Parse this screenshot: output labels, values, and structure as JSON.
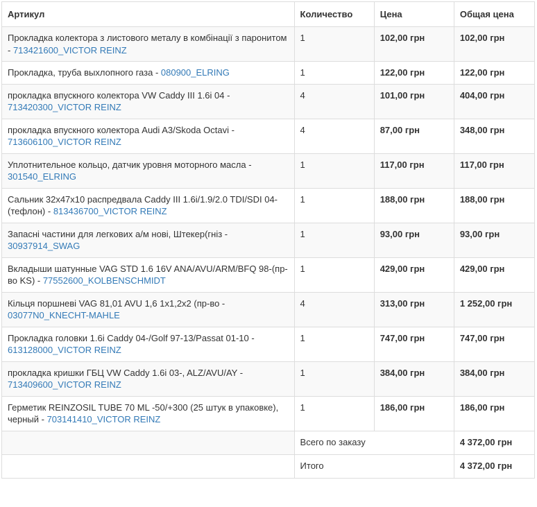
{
  "headers": {
    "article": "Артикул",
    "quantity": "Количество",
    "price": "Цена",
    "total": "Общая цена"
  },
  "rows": [
    {
      "name": "Прокладка колектора з листового металу в комбінації з паронитом - ",
      "sku": "713421600_VICTOR REINZ",
      "qty": "1",
      "price": "102,00 грн",
      "total": "102,00 грн"
    },
    {
      "name": "Прокладка, труба выхлопного газа - ",
      "sku": "080900_ELRING",
      "qty": "1",
      "price": "122,00 грн",
      "total": "122,00 грн"
    },
    {
      "name": "прокладка впускного колектора VW Caddy III 1.6i 04 - ",
      "sku": "713420300_VICTOR REINZ",
      "qty": "4",
      "price": "101,00 грн",
      "total": "404,00 грн"
    },
    {
      "name": "прокладка впускного колектора Audi A3/Skoda Octavi - ",
      "sku": "713606100_VICTOR REINZ",
      "qty": "4",
      "price": "87,00 грн",
      "total": "348,00 грн"
    },
    {
      "name": "Уплотнительное кольцо, датчик уровня моторного масла - ",
      "sku": "301540_ELRING",
      "qty": "1",
      "price": "117,00 грн",
      "total": "117,00 грн"
    },
    {
      "name": "Сальник 32x47x10 распредвала Caddy III 1.6i/1.9/2.0 TDI/SDI 04-(тефлон) - ",
      "sku": "813436700_VICTOR REINZ",
      "qty": "1",
      "price": "188,00 грн",
      "total": "188,00 грн"
    },
    {
      "name": "Запасні частини для легкових а/м нові, Штекер(гніз - ",
      "sku": "30937914_SWAG",
      "qty": "1",
      "price": "93,00 грн",
      "total": "93,00 грн"
    },
    {
      "name": "Вкладыши шатунные VAG STD 1.6 16V ANA/AVU/ARM/BFQ 98-(пр-во KS) - ",
      "sku": "77552600_KOLBENSCHMIDT",
      "qty": "1",
      "price": "429,00 грн",
      "total": "429,00 грн"
    },
    {
      "name": "Кільця поршневі VAG 81,01 AVU 1,6 1x1,2x2 (пр-во - ",
      "sku": "03077N0_KNECHT-MAHLE",
      "qty": "4",
      "price": "313,00 грн",
      "total": "1 252,00 грн"
    },
    {
      "name": "Прокладка головки 1.6i Caddy 04-/Golf 97-13/Passat 01-10 - ",
      "sku": "613128000_VICTOR REINZ",
      "qty": "1",
      "price": "747,00 грн",
      "total": "747,00 грн"
    },
    {
      "name": "прокладка кришки ГБЦ VW Caddy 1.6i 03-, ALZ/AVU/AY - ",
      "sku": "713409600_VICTOR REINZ",
      "qty": "1",
      "price": "384,00 грн",
      "total": "384,00 грн"
    },
    {
      "name": "Герметик REINZOSIL TUBE 70 ML -50/+300 (25 штук в упаковке), черный - ",
      "sku": "703141410_VICTOR REINZ",
      "qty": "1",
      "price": "186,00 грн",
      "total": "186,00 грн"
    }
  ],
  "summary": {
    "order_total_label": "Всего по заказу",
    "order_total_value": "4 372,00 грн",
    "grand_total_label": "Итого",
    "grand_total_value": "4 372,00 грн"
  },
  "colors": {
    "link": "#337ab7",
    "stripe": "#f9f9f9",
    "border": "#dddddd"
  }
}
